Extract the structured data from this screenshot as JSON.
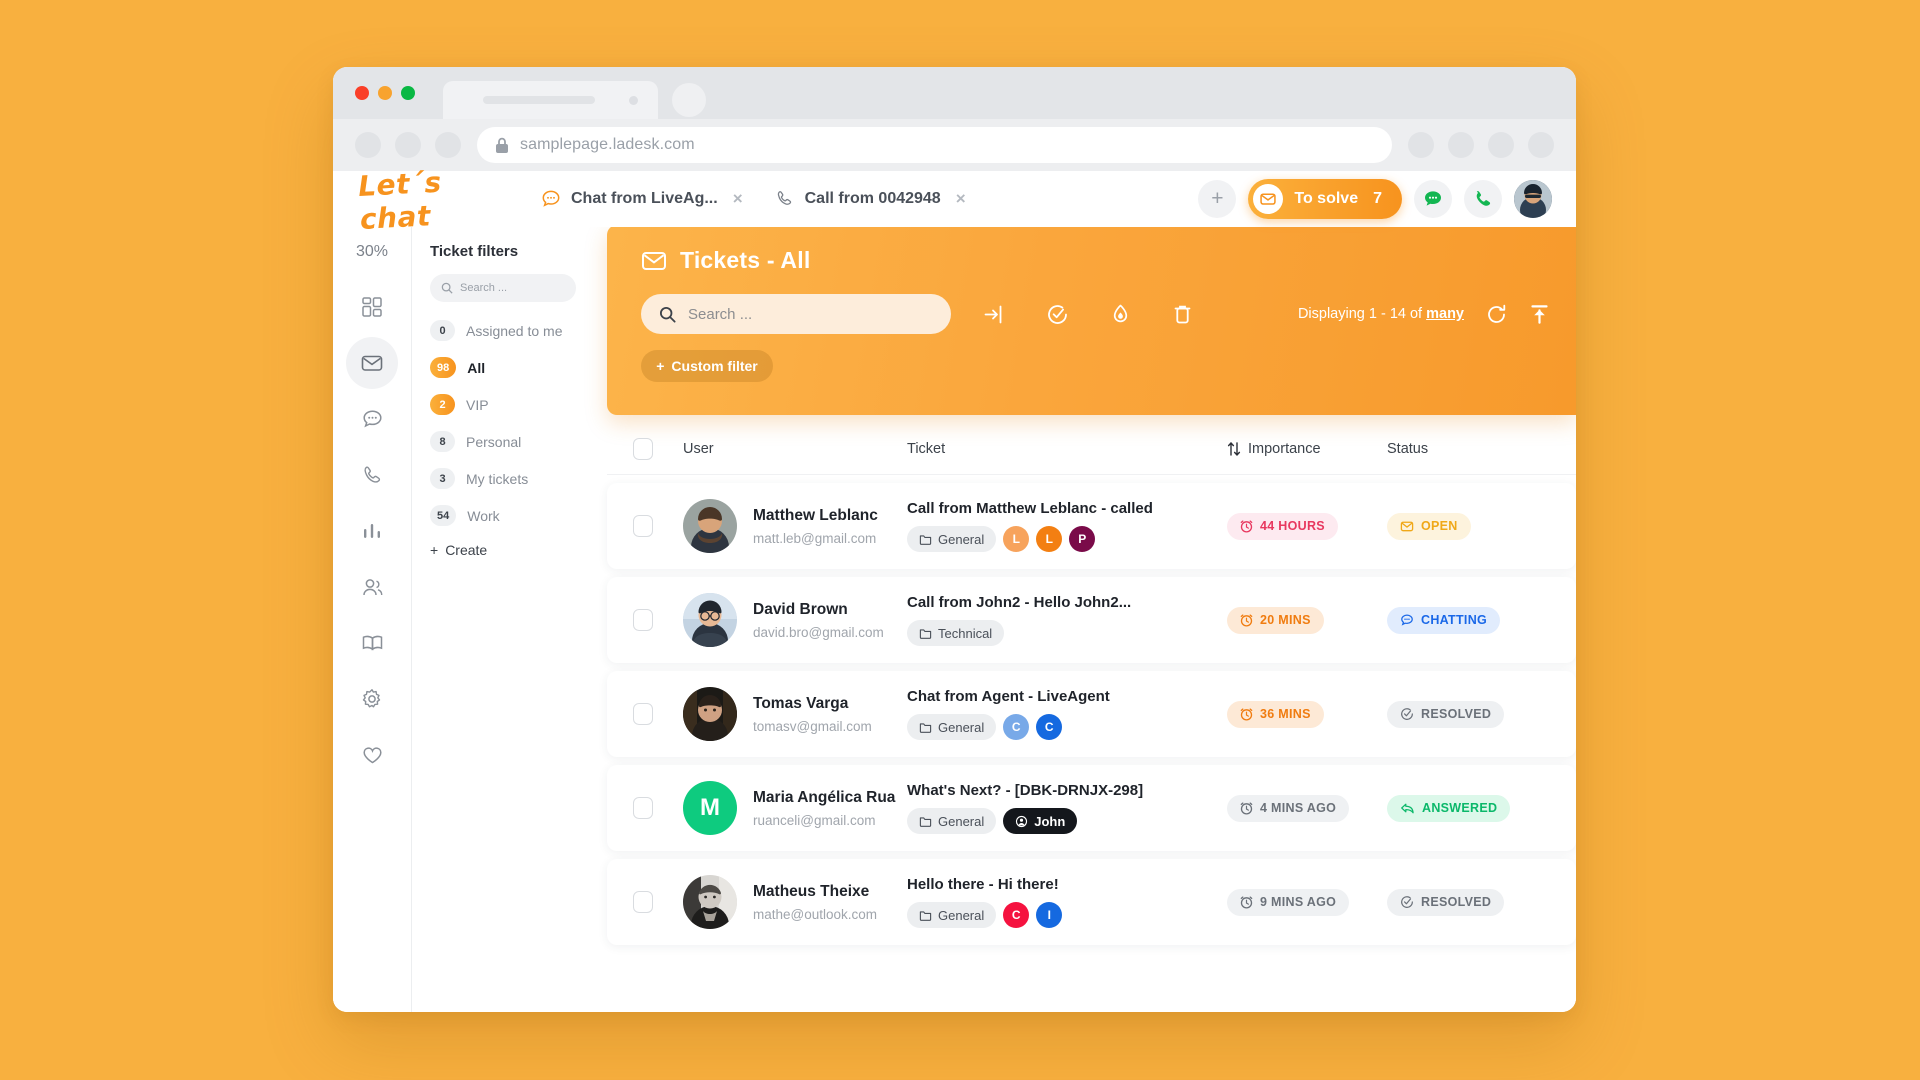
{
  "browser": {
    "url": "samplepage.ladesk.com",
    "lock_icon": "lock-icon"
  },
  "app": {
    "logo": "Let´s chat",
    "progress": "30%",
    "tabs": [
      {
        "icon": "chat-bubble-icon",
        "label": "Chat from LiveAg...",
        "close": "×"
      },
      {
        "icon": "phone-icon",
        "label": "Call from 0042948",
        "close": "×"
      }
    ],
    "header_actions": {
      "plus": "+",
      "to_solve_label": "To solve",
      "to_solve_count": "7",
      "mail_icon": "mail-icon",
      "chat_icon": "chat-icon",
      "phone_icon": "phone-icon",
      "avatar": "avatar"
    },
    "rail_icons": [
      "dashboard-icon",
      "mail-icon",
      "chat-icon",
      "phone-icon",
      "chart-icon",
      "people-icon",
      "book-icon",
      "gear-icon",
      "heart-icon"
    ]
  },
  "filters": {
    "title": "Ticket filters",
    "search_placeholder": "Search ...",
    "items": [
      {
        "count": "0",
        "label": "Assigned to me",
        "active": false,
        "highlight": false
      },
      {
        "count": "98",
        "label": "All",
        "active": true,
        "highlight": true
      },
      {
        "count": "2",
        "label": "VIP",
        "active": false,
        "highlight": true
      },
      {
        "count": "8",
        "label": "Personal",
        "active": false,
        "highlight": false
      },
      {
        "count": "3",
        "label": "My tickets",
        "active": false,
        "highlight": false
      },
      {
        "count": "54",
        "label": "Work",
        "active": false,
        "highlight": false
      }
    ],
    "create_label": "Create"
  },
  "panel": {
    "title": "Tickets - All",
    "title_icon": "mail-icon",
    "search_placeholder": "Search ...",
    "toolbar_icons": [
      "assign-icon",
      "resolve-icon",
      "flame-icon",
      "trash-icon"
    ],
    "displaying_prefix": "Displaying 1 - 14 of",
    "displaying_link": "many",
    "refresh_icon": "refresh-icon",
    "export_icon": "export-icon",
    "custom_filter_label": "Custom filter"
  },
  "table": {
    "columns": [
      "User",
      "Ticket",
      "Importance",
      "Status"
    ],
    "sort_icon": "sort-icon",
    "rows": [
      {
        "name": "Matthew Leblanc",
        "email": "matt.leb@gmail.com",
        "subject": "Call from Matthew Leblanc - called",
        "department": "General",
        "tags": [
          {
            "letter": "L",
            "color": "#f7a35c"
          },
          {
            "letter": "L",
            "color": "#f37f12"
          },
          {
            "letter": "P",
            "color": "#7a0b49"
          }
        ],
        "importance": "44 HOURS",
        "importance_bg": "#fdeaf0",
        "importance_fg": "#e8385f",
        "status": "OPEN",
        "status_bg": "#fdf3dd",
        "status_fg": "#f0a818",
        "status_icon": "open-icon",
        "avatar_type": "photo",
        "avatar_color": "#8a7f6e"
      },
      {
        "name": "David Brown",
        "email": "david.bro@gmail.com",
        "subject": "Call from John2 - Hello John2...",
        "department": "Technical",
        "tags": [],
        "importance": "20 MINS",
        "importance_bg": "#fde9d6",
        "importance_fg": "#f07c10",
        "status": "CHATTING",
        "status_bg": "#e1ecfd",
        "status_fg": "#1a68e8",
        "status_icon": "chat-icon",
        "avatar_type": "photo",
        "avatar_color": "#7f94ab"
      },
      {
        "name": "Tomas Varga",
        "email": "tomasv@gmail.com",
        "subject": "Chat from Agent - LiveAgent",
        "department": "General",
        "tags": [
          {
            "letter": "C",
            "color": "#78a9e8"
          },
          {
            "letter": "C",
            "color": "#1569e0"
          }
        ],
        "importance": "36 MINS",
        "importance_bg": "#fde9d6",
        "importance_fg": "#f07c10",
        "status": "RESOLVED",
        "status_bg": "#eef0f2",
        "status_fg": "#6b7179",
        "status_icon": "check-icon",
        "avatar_type": "photo",
        "avatar_color": "#4b3f38"
      },
      {
        "name": "Maria Angélica Rua",
        "email": "ruanceli@gmail.com",
        "subject": "What's Next? - [DBK-DRNJX-298]",
        "department": "General",
        "tags": [],
        "dark_tag": "John",
        "importance": "4 MINS AGO",
        "importance_bg": "#eff1f3",
        "importance_fg": "#6b7179",
        "status": "ANSWERED",
        "status_bg": "#dcf8ea",
        "status_fg": "#0bb86a",
        "status_icon": "reply-icon",
        "avatar_type": "initial",
        "avatar_initial": "M",
        "avatar_color": "#0ecb7f"
      },
      {
        "name": "Matheus Theixe",
        "email": "mathe@outlook.com",
        "subject": "Hello there - Hi there!",
        "department": "General",
        "tags": [
          {
            "letter": "C",
            "color": "#f5123f"
          },
          {
            "letter": "I",
            "color": "#1569e0"
          }
        ],
        "importance": "9 MINS AGO",
        "importance_bg": "#eff1f3",
        "importance_fg": "#6b7179",
        "status": "RESOLVED",
        "status_bg": "#eef0f2",
        "status_fg": "#6b7179",
        "status_icon": "check-icon",
        "avatar_type": "photo",
        "avatar_color": "#5a5a5a"
      }
    ]
  },
  "colors": {
    "page_bg": "#f8b03f",
    "accent": "#f7931e",
    "panel_from": "#fcb44a",
    "panel_to": "#f79a2c"
  }
}
